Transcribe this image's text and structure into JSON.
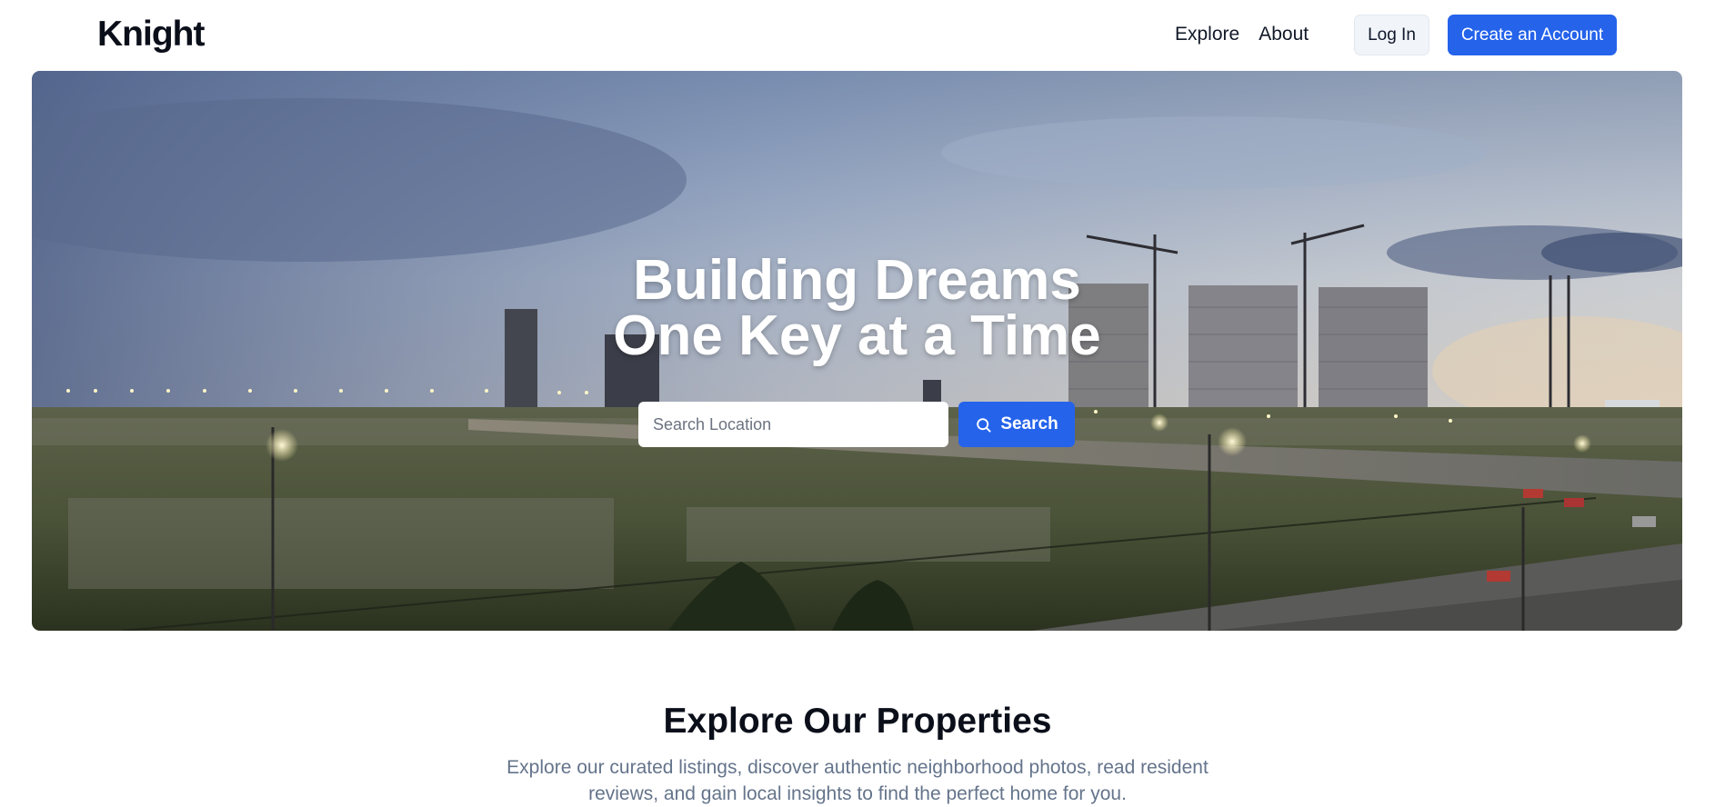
{
  "nav": {
    "brand": "Knight",
    "links": [
      "Explore",
      "About"
    ],
    "login_label": "Log In",
    "create_label": "Create an Account"
  },
  "hero": {
    "title_line1": "Building Dreams",
    "title_line2": "One Key at a Time",
    "search_placeholder": "Search Location",
    "search_label": "Search"
  },
  "explore": {
    "title": "Explore Our Properties",
    "description": "Explore our curated listings, discover authentic neighborhood photos, read resident reviews, and gain local insights to find the perfect home for you."
  },
  "colors": {
    "primary": "#2563eb",
    "muted_text": "#64748b",
    "dark_text": "#0f172a"
  }
}
